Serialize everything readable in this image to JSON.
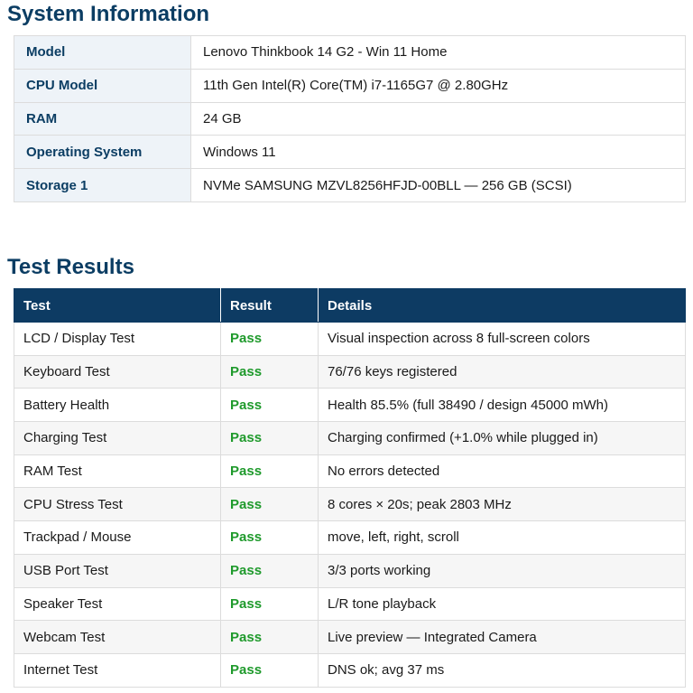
{
  "system_info": {
    "title": "System Information",
    "rows": [
      {
        "label": "Model",
        "value": "Lenovo Thinkbook 14 G2 - Win 11 Home"
      },
      {
        "label": "CPU Model",
        "value": "11th Gen Intel(R) Core(TM) i7-1165G7 @ 2.80GHz"
      },
      {
        "label": "RAM",
        "value": "24 GB"
      },
      {
        "label": "Operating System",
        "value": "Windows 11"
      },
      {
        "label": "Storage 1",
        "value": "NVMe SAMSUNG MZVL8256HFJD-00BLL — 256 GB (SCSI)"
      }
    ]
  },
  "test_results": {
    "title": "Test Results",
    "headers": {
      "test": "Test",
      "result": "Result",
      "details": "Details"
    },
    "pass_color": "#1f9a2c",
    "rows": [
      {
        "test": "LCD / Display Test",
        "result": "Pass",
        "details": "Visual inspection across 8 full-screen colors"
      },
      {
        "test": "Keyboard Test",
        "result": "Pass",
        "details": "76/76 keys registered"
      },
      {
        "test": "Battery Health",
        "result": "Pass",
        "details": "Health 85.5% (full 38490 / design 45000 mWh)"
      },
      {
        "test": "Charging Test",
        "result": "Pass",
        "details": "Charging confirmed (+1.0% while plugged in)"
      },
      {
        "test": "RAM Test",
        "result": "Pass",
        "details": "No errors detected"
      },
      {
        "test": "CPU Stress Test",
        "result": "Pass",
        "details": "8 cores × 20s; peak 2803 MHz"
      },
      {
        "test": "Trackpad / Mouse",
        "result": "Pass",
        "details": "move, left, right, scroll"
      },
      {
        "test": "USB Port Test",
        "result": "Pass",
        "details": "3/3 ports working"
      },
      {
        "test": "Speaker Test",
        "result": "Pass",
        "details": "L/R tone playback"
      },
      {
        "test": "Webcam Test",
        "result": "Pass",
        "details": "Live preview — Integrated Camera"
      },
      {
        "test": "Internet Test",
        "result": "Pass",
        "details": "DNS ok; avg 37 ms"
      }
    ]
  }
}
